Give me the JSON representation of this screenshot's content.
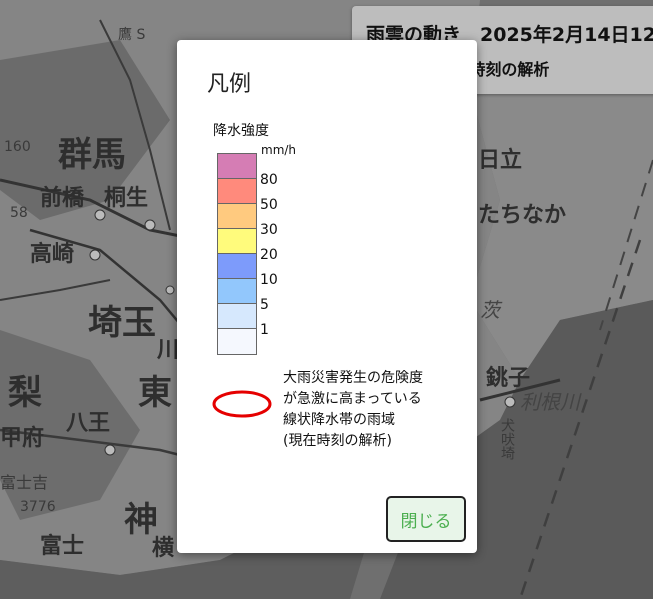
{
  "map": {
    "labels": [
      {
        "id": "gunma",
        "text": "群馬"
      },
      {
        "id": "maebashi",
        "text": "前橋"
      },
      {
        "id": "kiryu",
        "text": "桐生"
      },
      {
        "id": "takasaki",
        "text": "高崎"
      },
      {
        "id": "saitama",
        "text": "埼玉"
      },
      {
        "id": "kawa",
        "text": "川"
      },
      {
        "id": "nashi",
        "text": "梨"
      },
      {
        "id": "kofu",
        "text": "甲府"
      },
      {
        "id": "hachio",
        "text": "八王"
      },
      {
        "id": "higashi",
        "text": "東"
      },
      {
        "id": "fujiyoshida",
        "text": "富士吉"
      },
      {
        "id": "fuji",
        "text": "富士"
      },
      {
        "id": "kana",
        "text": "神"
      },
      {
        "id": "yoko",
        "text": "横"
      },
      {
        "id": "hitachi",
        "text": "日立"
      },
      {
        "id": "hitachinaka",
        "text": "たちなか"
      },
      {
        "id": "choshi",
        "text": "銚子"
      },
      {
        "id": "tone",
        "text": "利根川"
      },
      {
        "id": "inubo",
        "text": "犬吠埼"
      },
      {
        "id": "ibara",
        "text": "茨"
      },
      {
        "id": "num160",
        "text": "160"
      },
      {
        "id": "num58",
        "text": "58"
      },
      {
        "id": "num3776",
        "text": "3776"
      },
      {
        "id": "kanji_top",
        "text": "鷹 S"
      }
    ]
  },
  "header": {
    "line1": "雨雲の動き　2025年2月14日12",
    "line2": "状降水帯(現在時刻の解析"
  },
  "legend": {
    "title": "凡例",
    "heading": "降水強度",
    "unit": "mm/h",
    "colors": [
      "#d57db4",
      "#ff8a7c",
      "#ffca7f",
      "#fffb7c",
      "#7d9bfb",
      "#92c7fc",
      "#d6e8fd",
      "#f5f8fe"
    ],
    "ticks": [
      "80",
      "50",
      "30",
      "20",
      "10",
      "5",
      "1"
    ],
    "ring_color": "#e50000",
    "ring_icon": "red-ring-icon",
    "ring_lines": [
      "大雨災害発生の危険度",
      "が急激に高まっている",
      "線状降水帯の雨域",
      "(現在時刻の解析)"
    ]
  },
  "buttons": {
    "close_label": "閉じる"
  }
}
